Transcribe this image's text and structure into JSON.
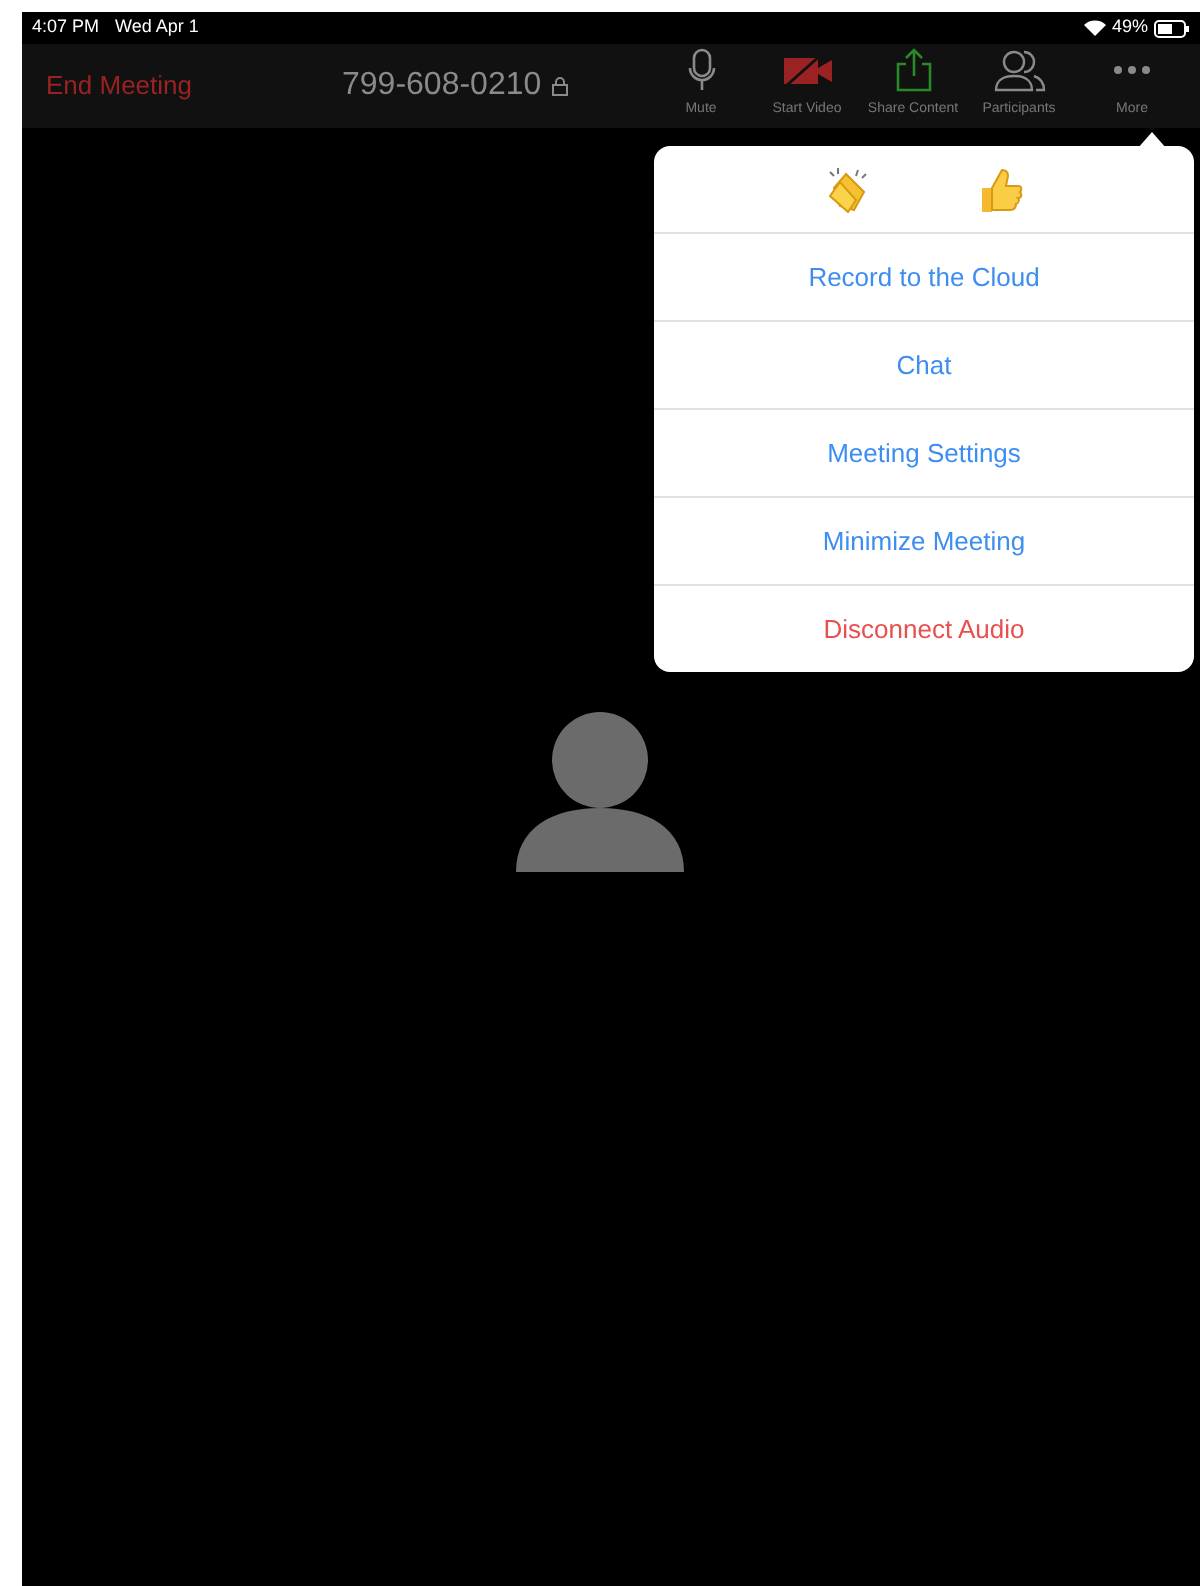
{
  "status_bar": {
    "time": "4:07 PM",
    "date": "Wed Apr 1",
    "battery": "49%"
  },
  "toolbar": {
    "end_meeting": "End Meeting",
    "meeting_id": "799-608-0210",
    "buttons": [
      {
        "kind": "mic",
        "label": "Mute"
      },
      {
        "kind": "video_off",
        "label": "Start Video"
      },
      {
        "kind": "share",
        "label": "Share Content"
      },
      {
        "kind": "participants",
        "label": "Participants"
      },
      {
        "kind": "more",
        "label": "More"
      }
    ]
  },
  "more_menu": {
    "reactions": [
      {
        "kind": "clap"
      },
      {
        "kind": "thumbs_up"
      }
    ],
    "items": [
      {
        "label": "Record to the Cloud",
        "kind": "normal"
      },
      {
        "label": "Chat",
        "kind": "normal"
      },
      {
        "label": "Meeting Settings",
        "kind": "normal"
      },
      {
        "label": "Minimize Meeting",
        "kind": "normal"
      },
      {
        "label": "Disconnect Audio",
        "kind": "danger"
      }
    ]
  }
}
